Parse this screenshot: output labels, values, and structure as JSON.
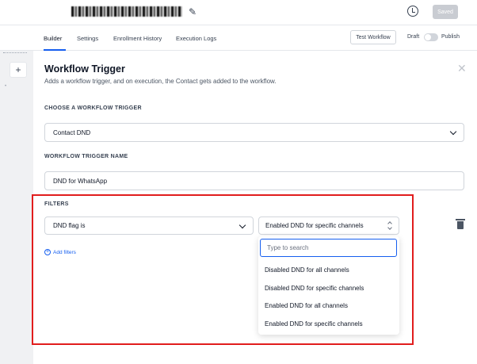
{
  "header": {
    "saved_label": "Saved"
  },
  "tabs": [
    {
      "label": "Builder",
      "active": true
    },
    {
      "label": "Settings"
    },
    {
      "label": "Enrollment History"
    },
    {
      "label": "Execution Logs"
    }
  ],
  "actions": {
    "test_workflow": "Test Workflow",
    "draft": "Draft",
    "publish": "Publish"
  },
  "canvas": {
    "add_label": "+"
  },
  "panel": {
    "title": "Workflow Trigger",
    "subtitle": "Adds a workflow trigger, and on execution, the Contact gets added to the workflow.",
    "choose_label": "CHOOSE A WORKFLOW TRIGGER",
    "trigger_value": "Contact DND",
    "name_label": "WORKFLOW TRIGGER NAME",
    "name_value": "DND for WhatsApp"
  },
  "filters": {
    "label": "FILTERS",
    "field_value": "DND flag is",
    "selected_value": "Enabled DND for specific channels",
    "add_label": "Add filters",
    "search_placeholder": "Type to search",
    "options": [
      "Disabled DND for all channels",
      "Disabled DND for specific channels",
      "Enabled DND for all channels",
      "Enabled DND for specific channels"
    ]
  },
  "colors": {
    "accent": "#155eef",
    "highlight": "#e11d1d"
  }
}
